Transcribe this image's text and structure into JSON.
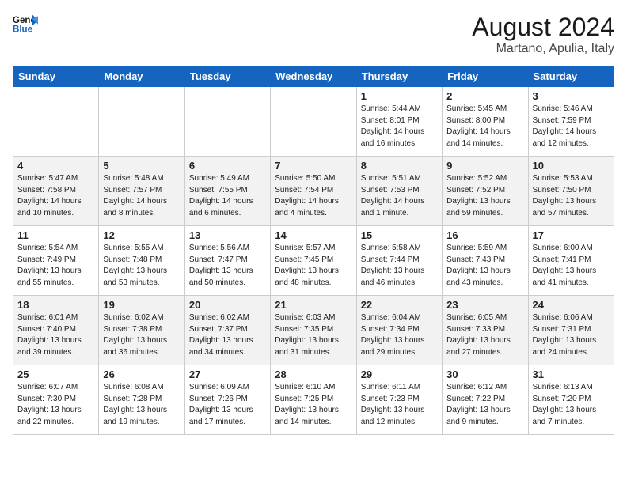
{
  "header": {
    "logo_general": "General",
    "logo_blue": "Blue",
    "month_year": "August 2024",
    "location": "Martano, Apulia, Italy"
  },
  "weekdays": [
    "Sunday",
    "Monday",
    "Tuesday",
    "Wednesday",
    "Thursday",
    "Friday",
    "Saturday"
  ],
  "weeks": [
    [
      {
        "day": "",
        "info": ""
      },
      {
        "day": "",
        "info": ""
      },
      {
        "day": "",
        "info": ""
      },
      {
        "day": "",
        "info": ""
      },
      {
        "day": "1",
        "info": "Sunrise: 5:44 AM\nSunset: 8:01 PM\nDaylight: 14 hours\nand 16 minutes."
      },
      {
        "day": "2",
        "info": "Sunrise: 5:45 AM\nSunset: 8:00 PM\nDaylight: 14 hours\nand 14 minutes."
      },
      {
        "day": "3",
        "info": "Sunrise: 5:46 AM\nSunset: 7:59 PM\nDaylight: 14 hours\nand 12 minutes."
      }
    ],
    [
      {
        "day": "4",
        "info": "Sunrise: 5:47 AM\nSunset: 7:58 PM\nDaylight: 14 hours\nand 10 minutes."
      },
      {
        "day": "5",
        "info": "Sunrise: 5:48 AM\nSunset: 7:57 PM\nDaylight: 14 hours\nand 8 minutes."
      },
      {
        "day": "6",
        "info": "Sunrise: 5:49 AM\nSunset: 7:55 PM\nDaylight: 14 hours\nand 6 minutes."
      },
      {
        "day": "7",
        "info": "Sunrise: 5:50 AM\nSunset: 7:54 PM\nDaylight: 14 hours\nand 4 minutes."
      },
      {
        "day": "8",
        "info": "Sunrise: 5:51 AM\nSunset: 7:53 PM\nDaylight: 14 hours\nand 1 minute."
      },
      {
        "day": "9",
        "info": "Sunrise: 5:52 AM\nSunset: 7:52 PM\nDaylight: 13 hours\nand 59 minutes."
      },
      {
        "day": "10",
        "info": "Sunrise: 5:53 AM\nSunset: 7:50 PM\nDaylight: 13 hours\nand 57 minutes."
      }
    ],
    [
      {
        "day": "11",
        "info": "Sunrise: 5:54 AM\nSunset: 7:49 PM\nDaylight: 13 hours\nand 55 minutes."
      },
      {
        "day": "12",
        "info": "Sunrise: 5:55 AM\nSunset: 7:48 PM\nDaylight: 13 hours\nand 53 minutes."
      },
      {
        "day": "13",
        "info": "Sunrise: 5:56 AM\nSunset: 7:47 PM\nDaylight: 13 hours\nand 50 minutes."
      },
      {
        "day": "14",
        "info": "Sunrise: 5:57 AM\nSunset: 7:45 PM\nDaylight: 13 hours\nand 48 minutes."
      },
      {
        "day": "15",
        "info": "Sunrise: 5:58 AM\nSunset: 7:44 PM\nDaylight: 13 hours\nand 46 minutes."
      },
      {
        "day": "16",
        "info": "Sunrise: 5:59 AM\nSunset: 7:43 PM\nDaylight: 13 hours\nand 43 minutes."
      },
      {
        "day": "17",
        "info": "Sunrise: 6:00 AM\nSunset: 7:41 PM\nDaylight: 13 hours\nand 41 minutes."
      }
    ],
    [
      {
        "day": "18",
        "info": "Sunrise: 6:01 AM\nSunset: 7:40 PM\nDaylight: 13 hours\nand 39 minutes."
      },
      {
        "day": "19",
        "info": "Sunrise: 6:02 AM\nSunset: 7:38 PM\nDaylight: 13 hours\nand 36 minutes."
      },
      {
        "day": "20",
        "info": "Sunrise: 6:02 AM\nSunset: 7:37 PM\nDaylight: 13 hours\nand 34 minutes."
      },
      {
        "day": "21",
        "info": "Sunrise: 6:03 AM\nSunset: 7:35 PM\nDaylight: 13 hours\nand 31 minutes."
      },
      {
        "day": "22",
        "info": "Sunrise: 6:04 AM\nSunset: 7:34 PM\nDaylight: 13 hours\nand 29 minutes."
      },
      {
        "day": "23",
        "info": "Sunrise: 6:05 AM\nSunset: 7:33 PM\nDaylight: 13 hours\nand 27 minutes."
      },
      {
        "day": "24",
        "info": "Sunrise: 6:06 AM\nSunset: 7:31 PM\nDaylight: 13 hours\nand 24 minutes."
      }
    ],
    [
      {
        "day": "25",
        "info": "Sunrise: 6:07 AM\nSunset: 7:30 PM\nDaylight: 13 hours\nand 22 minutes."
      },
      {
        "day": "26",
        "info": "Sunrise: 6:08 AM\nSunset: 7:28 PM\nDaylight: 13 hours\nand 19 minutes."
      },
      {
        "day": "27",
        "info": "Sunrise: 6:09 AM\nSunset: 7:26 PM\nDaylight: 13 hours\nand 17 minutes."
      },
      {
        "day": "28",
        "info": "Sunrise: 6:10 AM\nSunset: 7:25 PM\nDaylight: 13 hours\nand 14 minutes."
      },
      {
        "day": "29",
        "info": "Sunrise: 6:11 AM\nSunset: 7:23 PM\nDaylight: 13 hours\nand 12 minutes."
      },
      {
        "day": "30",
        "info": "Sunrise: 6:12 AM\nSunset: 7:22 PM\nDaylight: 13 hours\nand 9 minutes."
      },
      {
        "day": "31",
        "info": "Sunrise: 6:13 AM\nSunset: 7:20 PM\nDaylight: 13 hours\nand 7 minutes."
      }
    ]
  ]
}
